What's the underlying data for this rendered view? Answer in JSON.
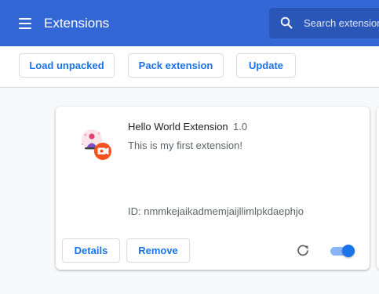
{
  "header": {
    "title": "Extensions",
    "menu_icon": "hamburger-menu-icon",
    "search_icon": "search-icon",
    "search_placeholder": "Search extensions",
    "color": "#3367d6"
  },
  "toolbar": {
    "load_unpacked_label": "Load unpacked",
    "pack_extension_label": "Pack extension",
    "update_label": "Update"
  },
  "extension": {
    "name": "Hello World Extension",
    "version": "1.0",
    "description": "This is my first extension!",
    "id_text": "ID: nmmkejaikadmemjaijllimlpkdaephjo",
    "icon": "extension-logo-icon",
    "details_label": "Details",
    "remove_label": "Remove",
    "reload_icon": "reload-icon",
    "enabled": true
  },
  "colors": {
    "accent": "#1a73e8",
    "toggle_track": "#8ab4f8",
    "badge": "#f4511e"
  }
}
